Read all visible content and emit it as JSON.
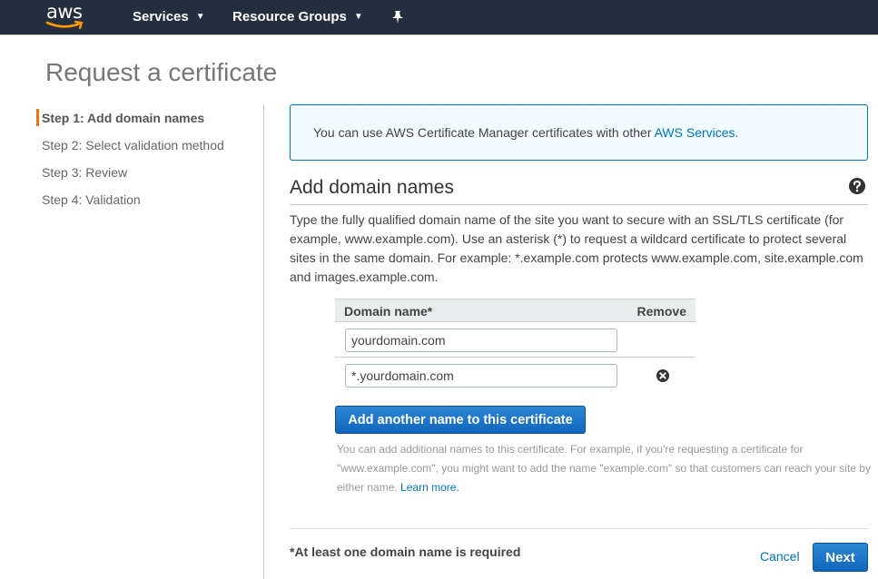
{
  "nav": {
    "logo_text": "aws",
    "services_label": "Services",
    "resource_groups_label": "Resource Groups",
    "chevron_glyph": "⌄"
  },
  "page": {
    "title": "Request a certificate"
  },
  "steps": [
    {
      "label": "Step 1: Add domain names",
      "active": true
    },
    {
      "label": "Step 2: Select validation method",
      "active": false
    },
    {
      "label": "Step 3: Review",
      "active": false
    },
    {
      "label": "Step 4: Validation",
      "active": false
    }
  ],
  "info": {
    "text": "You can use AWS Certificate Manager certificates with other ",
    "link": "AWS Services."
  },
  "section": {
    "title": "Add domain names",
    "description": "Type the fully qualified domain name of the site you want to secure with an SSL/TLS certificate (for example, www.example.com). Use an asterisk (*) to request a wildcard certificate to protect several sites in the same domain. For example: *.example.com protects www.example.com, site.example.com and images.example.com."
  },
  "domain_table": {
    "headers": {
      "domain": "Domain name*",
      "remove": "Remove"
    },
    "rows": [
      {
        "value": "yourdomain.com",
        "removable": false
      },
      {
        "value": "*.yourdomain.com",
        "removable": true
      }
    ]
  },
  "add_button_label": "Add another name to this certificate",
  "hint": {
    "text": "You can add additional names to this certificate. For example, if you're requesting a certificate for \"www.example.com\", you might want to add the name \"example.com\" so that customers can reach your site by either name. ",
    "link": "Learn more."
  },
  "footer": {
    "required_note": "*At least one domain name is required",
    "cancel_label": "Cancel",
    "next_label": "Next"
  },
  "colors": {
    "nav_bg": "#232f3e",
    "accent_orange": "#ec7211",
    "link_blue": "#0073bb",
    "button_blue": "#1166bb",
    "info_bg": "#f1faff"
  }
}
